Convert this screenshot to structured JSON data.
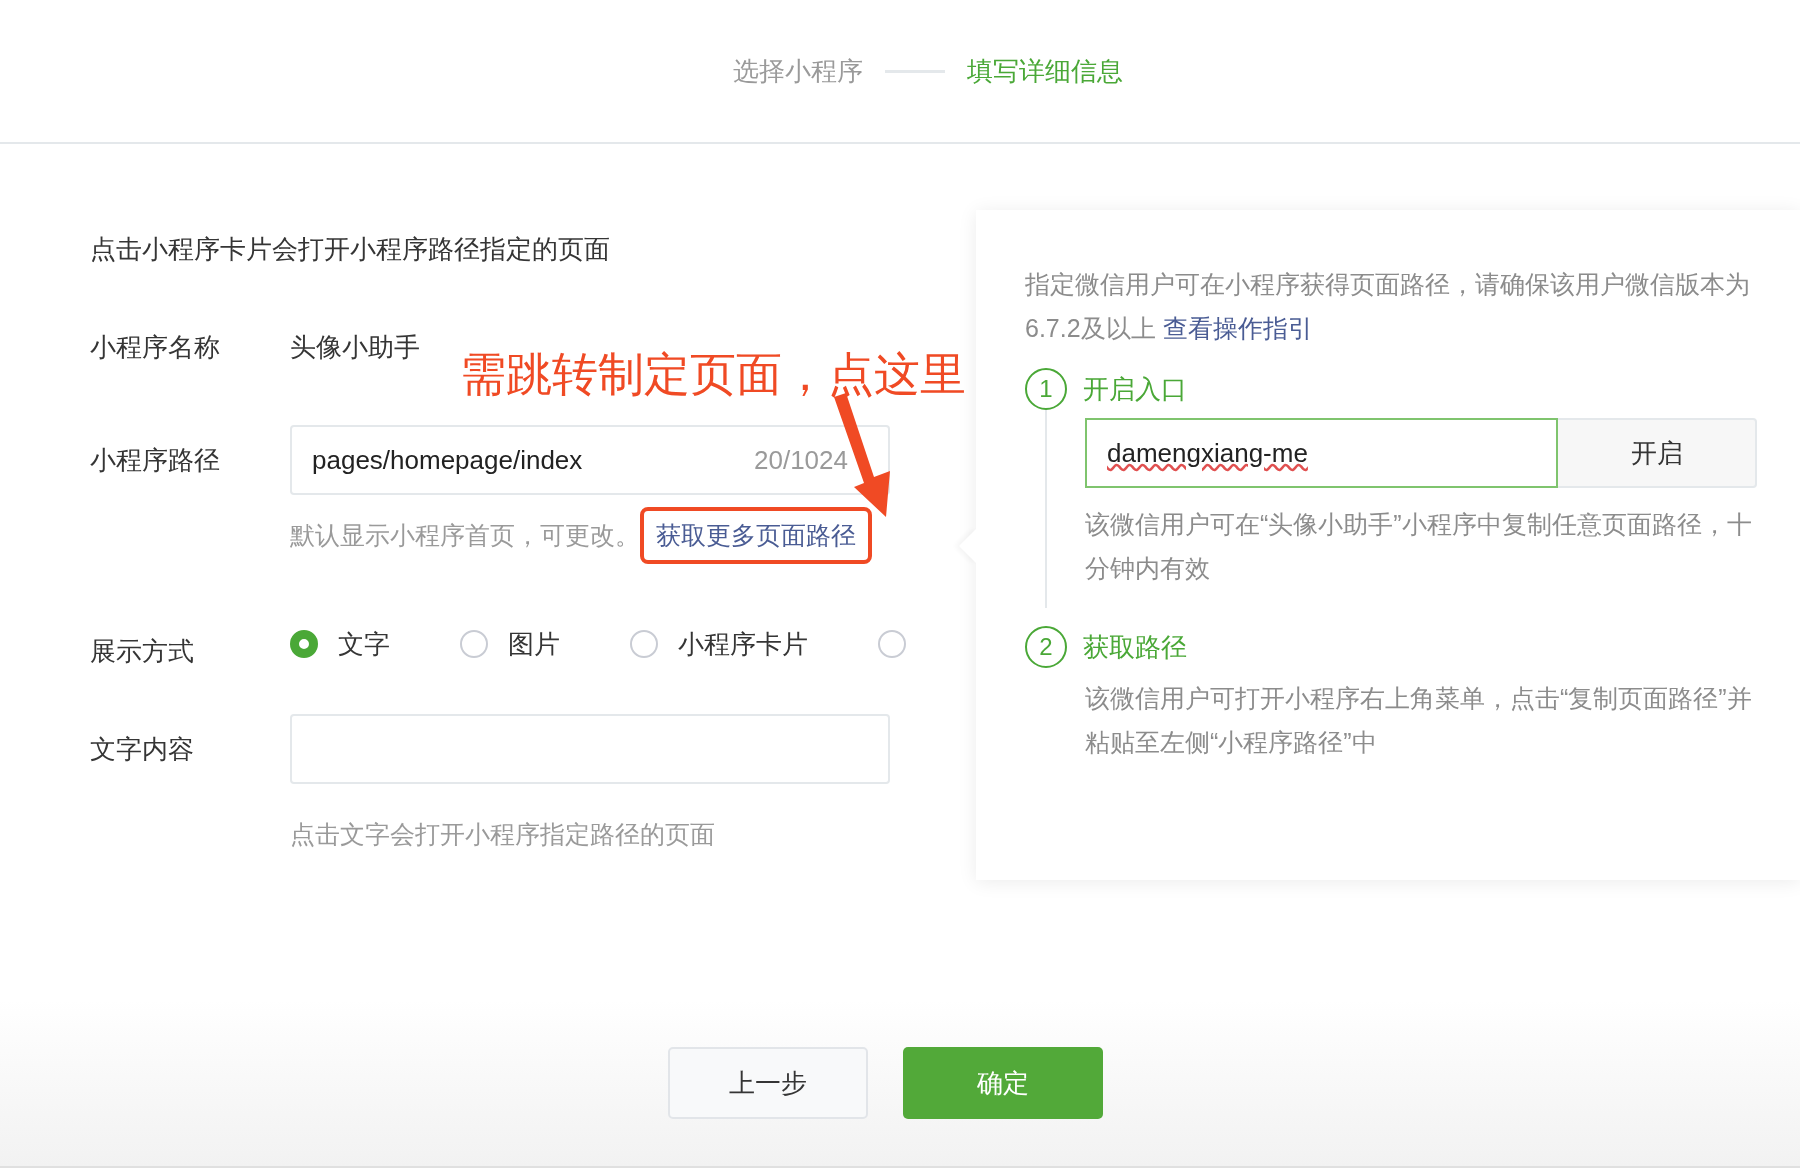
{
  "steps": [
    {
      "label": "选择小程序",
      "selected": false
    },
    {
      "label": "填写详细信息",
      "selected": true
    }
  ],
  "intro": "点击小程序卡片会打开小程序路径指定的页面",
  "name_field": {
    "label": "小程序名称",
    "value": "头像小助手"
  },
  "annotation": "需跳转制定页面，点这里",
  "path_field": {
    "label": "小程序路径",
    "value": "pages/homepage/index",
    "counter": "20/1024",
    "hint": "默认显示小程序首页，可更改。",
    "link": "获取更多页面路径"
  },
  "display_mode": {
    "label": "展示方式",
    "options": [
      {
        "label": "文字",
        "selected": true
      },
      {
        "label": "图片",
        "selected": false
      },
      {
        "label": "小程序卡片",
        "selected": false
      },
      {
        "selected": false
      }
    ]
  },
  "text_field": {
    "label": "文字内容",
    "hint": "点击文字会打开小程序指定路径的页面"
  },
  "panel": {
    "intro": "指定微信用户可在小程序获得页面路径，请确保该用户微信版本为6.7.2及以上",
    "guide_link": "查看操作指引",
    "steps": [
      {
        "number": "1",
        "title": "开启入口",
        "input_value": "damengxiang-me",
        "button": "开启",
        "desc": "该微信用户可在“头像小助手”小程序中复制任意页面路径，十分钟内有效"
      },
      {
        "number": "2",
        "title": "获取路径",
        "desc": "该微信用户可打开小程序右上角菜单，点击“复制页面路径”并粘贴至左侧“小程序路径”中"
      }
    ]
  },
  "buttons": [
    {
      "label": "上一步",
      "kind": "secondary"
    },
    {
      "label": "确定",
      "kind": "primary"
    }
  ]
}
